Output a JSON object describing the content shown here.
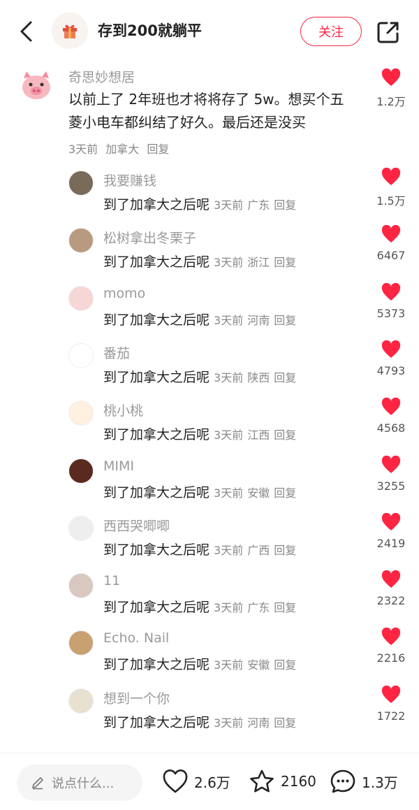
{
  "header": {
    "title": "存到200就躺平",
    "follow_label": "关注"
  },
  "main_comment": {
    "username": "奇思妙想居",
    "text": "以前上了 2年班也才将将存了 5w。想买个五菱小电车都纠结了好久。最后还是没买",
    "time": "3天前",
    "location": "加拿大",
    "reply_label": "回复",
    "likes": "1.2万"
  },
  "replies": [
    {
      "username": "我要赚钱",
      "text": "到了加拿大之后呢",
      "time": "3天前",
      "location": "广东",
      "reply_label": "回复",
      "likes": "1.5万"
    },
    {
      "username": "松树拿出冬栗子",
      "text": "到了加拿大之后呢",
      "time": "3天前",
      "location": "浙江",
      "reply_label": "回复",
      "likes": "6467"
    },
    {
      "username": "momo",
      "text": "到了加拿大之后呢",
      "time": "3天前",
      "location": "河南",
      "reply_label": "回复",
      "likes": "5373"
    },
    {
      "username": "番茄",
      "text": "到了加拿大之后呢",
      "time": "3天前",
      "location": "陕西",
      "reply_label": "回复",
      "likes": "4793"
    },
    {
      "username": "桃小桃",
      "text": "到了加拿大之后呢",
      "time": "3天前",
      "location": "江西",
      "reply_label": "回复",
      "likes": "4568"
    },
    {
      "username": "MIMI",
      "text": "到了加拿大之后呢",
      "time": "3天前",
      "location": "安徽",
      "reply_label": "回复",
      "likes": "3255"
    },
    {
      "username": "西西哭唧唧",
      "text": "到了加拿大之后呢",
      "time": "3天前",
      "location": "广西",
      "reply_label": "回复",
      "likes": "2419"
    },
    {
      "username": "11",
      "text": "到了加拿大之后呢",
      "time": "3天前",
      "location": "广东",
      "reply_label": "回复",
      "likes": "2322"
    },
    {
      "username": "Echo. Nail",
      "text": "到了加拿大之后呢",
      "time": "3天前",
      "location": "安徽",
      "reply_label": "回复",
      "likes": "2216"
    },
    {
      "username": "想到一个你",
      "text": "到了加拿大之后呢",
      "time": "3天前",
      "location": "河南",
      "reply_label": "回复",
      "likes": "1722"
    }
  ],
  "bottom_bar": {
    "input_placeholder": "说点什么...",
    "like_count": "2.6万",
    "collect_count": "2160",
    "comment_count": "1.3万"
  },
  "colors": {
    "accent": "#ff2442",
    "heart": "#ff2442",
    "muted_text": "#9a9a9a"
  },
  "icons": [
    "back-icon",
    "gift-icon",
    "share-icon",
    "heart-icon",
    "pencil-icon",
    "heart-outline-icon",
    "star-outline-icon",
    "chat-bubble-icon"
  ]
}
